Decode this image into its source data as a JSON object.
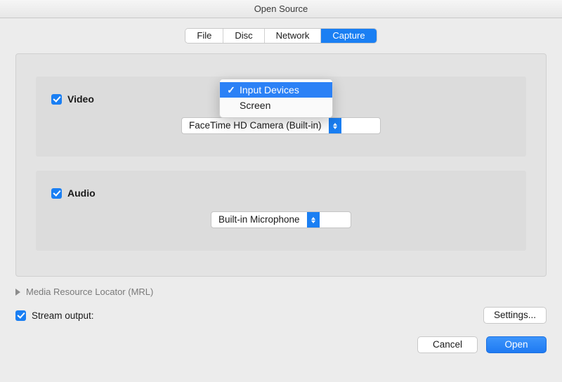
{
  "title": "Open Source",
  "tabs": {
    "file": "File",
    "disc": "Disc",
    "network": "Network",
    "capture": "Capture"
  },
  "popover": {
    "input_devices": "Input Devices",
    "screen": "Screen"
  },
  "video": {
    "label": "Video",
    "device": "FaceTime HD Camera (Built-in)"
  },
  "audio": {
    "label": "Audio",
    "device": "Built-in Microphone"
  },
  "mrl_label": "Media Resource Locator (MRL)",
  "stream_output_label": "Stream output:",
  "settings_label": "Settings...",
  "cancel_label": "Cancel",
  "open_label": "Open"
}
